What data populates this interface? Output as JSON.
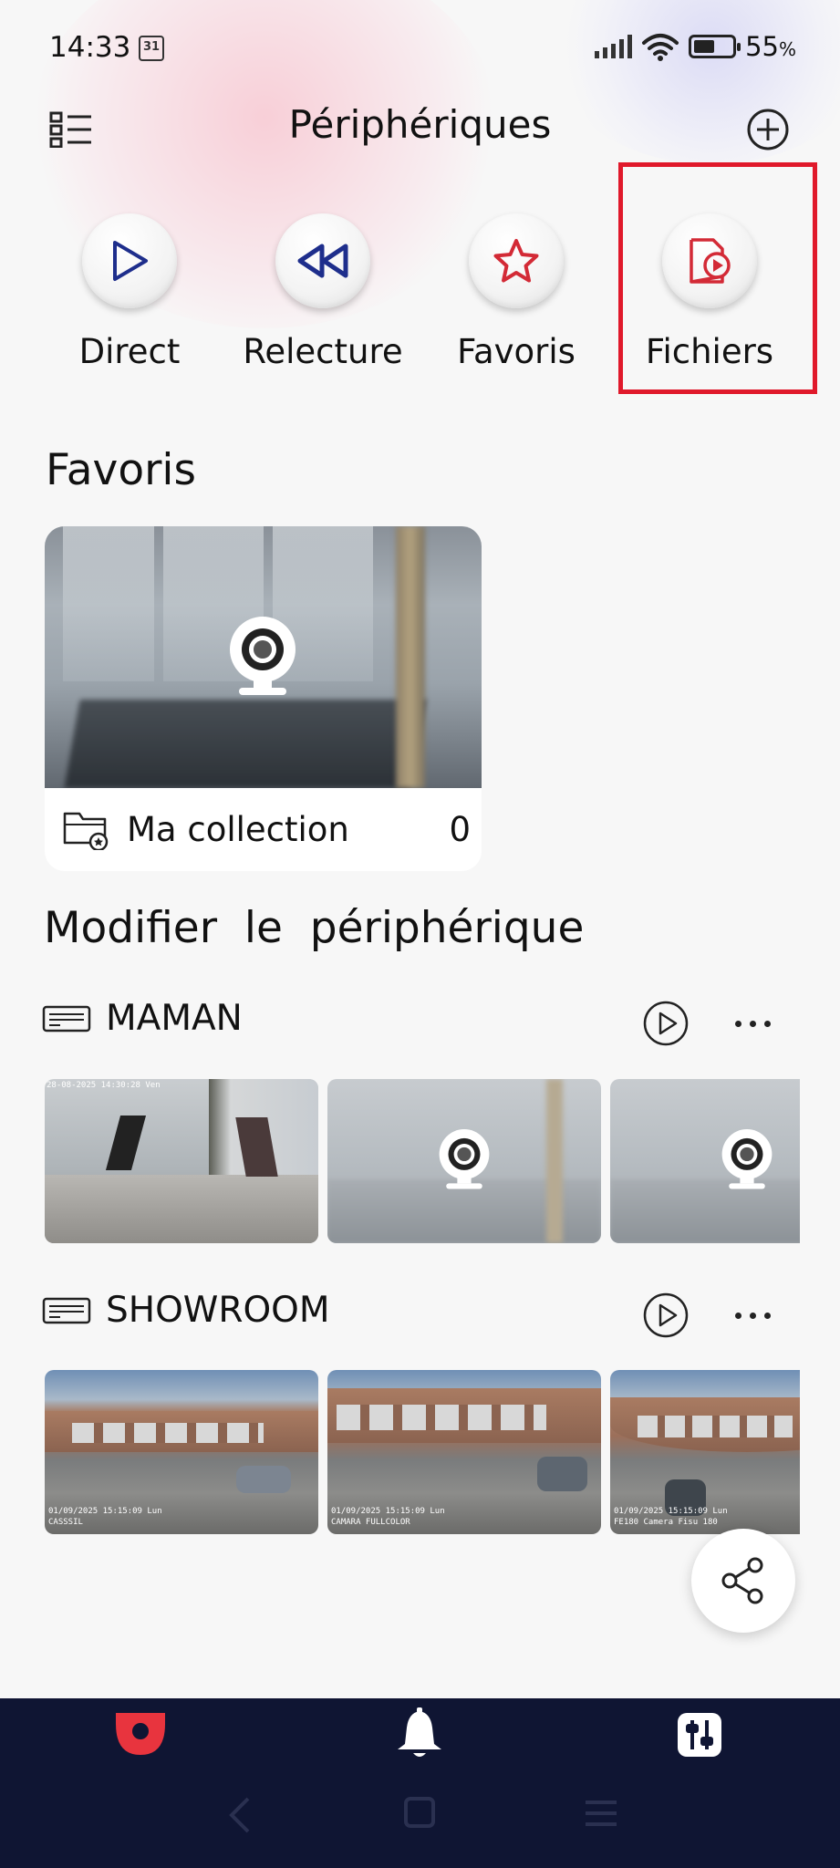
{
  "status_bar": {
    "time": "14:33",
    "calendar_day": "31",
    "battery_percent": "55",
    "battery_suffix": "%",
    "battery_level": 0.55
  },
  "header": {
    "title": "Périphériques",
    "menu_icon": "list-grid-icon",
    "add_icon": "plus-circle-icon"
  },
  "quick_actions": [
    {
      "label": "Direct",
      "icon": "play-icon"
    },
    {
      "label": "Relecture",
      "icon": "rewind-icon"
    },
    {
      "label": "Favoris",
      "icon": "star-icon"
    },
    {
      "label": "Fichiers",
      "icon": "file-video-icon"
    }
  ],
  "favorites": {
    "section_title": "Favoris",
    "collection_name": "Ma collection",
    "collection_count": "0"
  },
  "devices": {
    "section_title": "Modifier  le  périphérique",
    "items": [
      {
        "name": "MAMAN",
        "timestamps": [
          "28-08-2025 14:30:28 Ven"
        ]
      },
      {
        "name": "SHOWROOM",
        "timestamps": [
          "01/09/2025 15:15:09 Lun",
          "01/09/2025 15:15:09 Lun",
          "01/09/2025 15:15:09 Lun"
        ],
        "captions": [
          "CASSSIL",
          "CAMARA FULLCOLOR",
          "FE180 Camera Fisu 180"
        ]
      }
    ]
  },
  "bottom_tabs": [
    {
      "name": "devices-tab",
      "icon": "camera-icon",
      "active_color": "#e8343e"
    },
    {
      "name": "alerts-tab",
      "icon": "bell-icon"
    },
    {
      "name": "settings-tab",
      "icon": "sliders-icon"
    }
  ],
  "colors": {
    "accent": "#e0192b",
    "nav_bg": "#0f1533",
    "icon_blue": "#1e2e8c",
    "icon_red": "#d32a36"
  }
}
